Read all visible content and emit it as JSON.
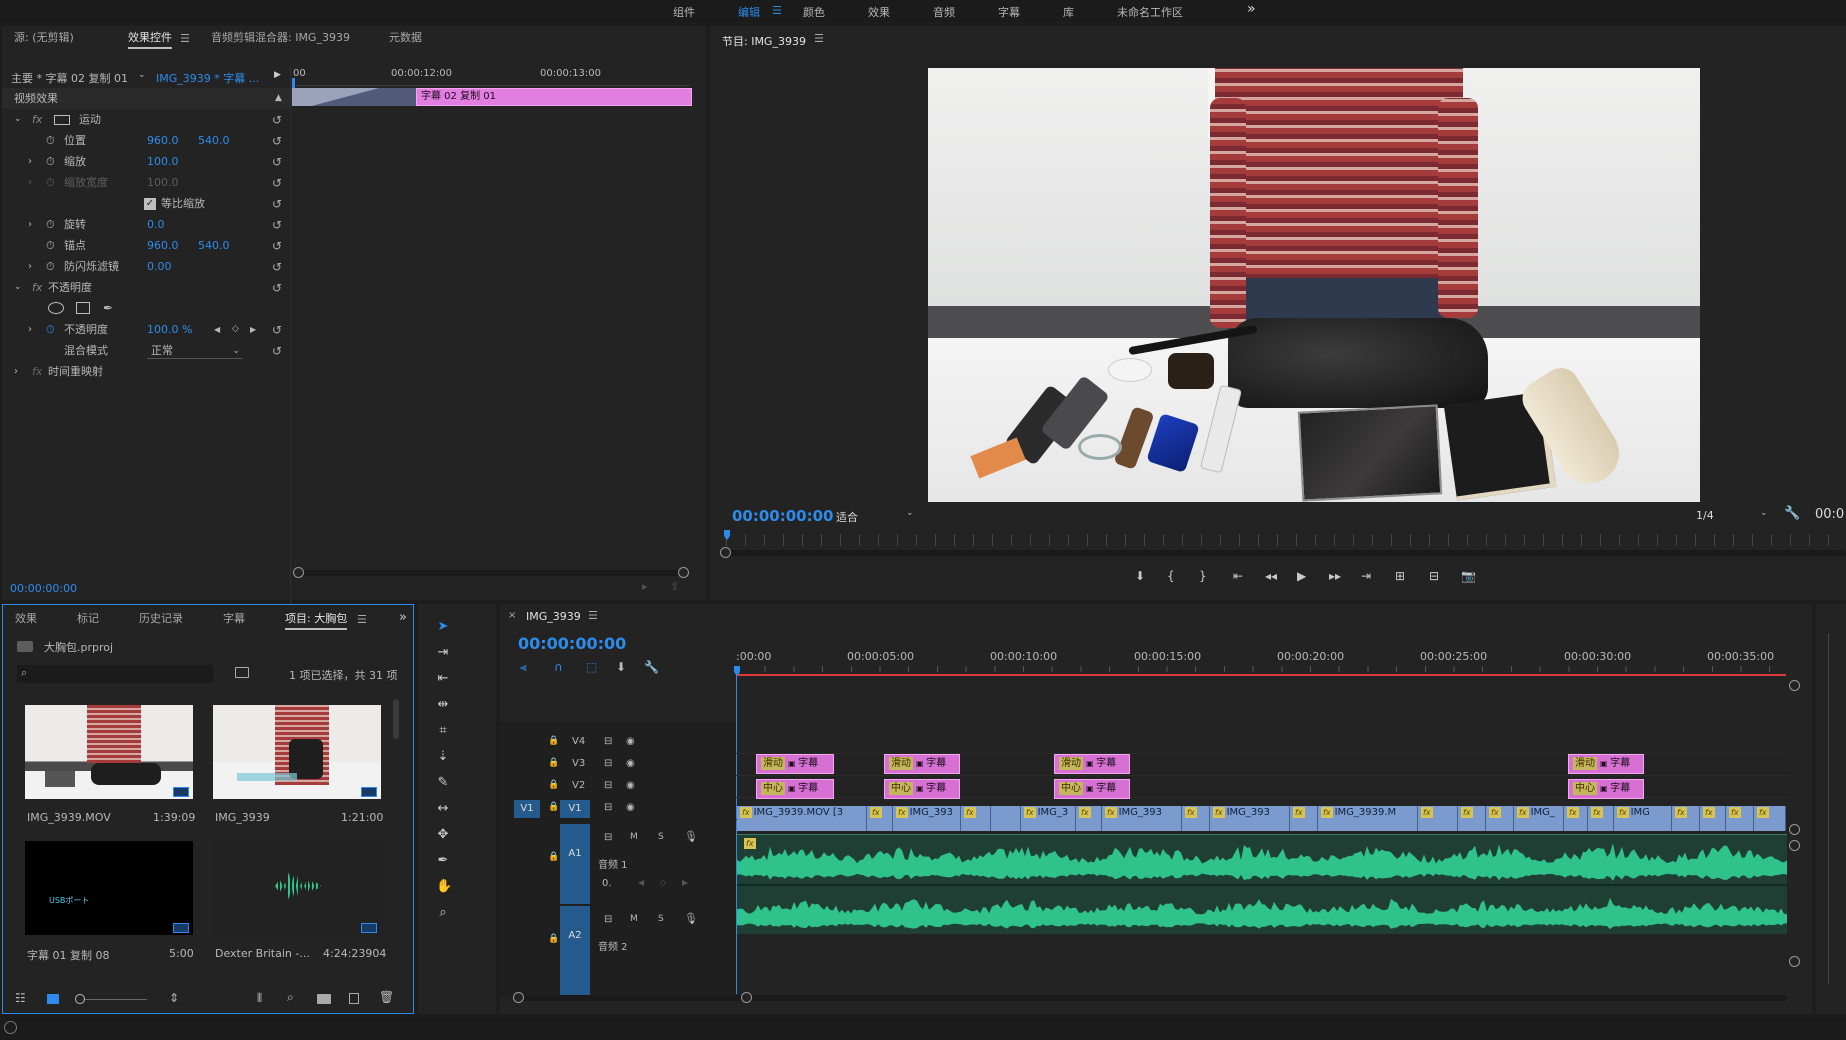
{
  "workspace_bar": {
    "tabs": [
      {
        "label": "组件"
      },
      {
        "label": "编辑"
      },
      {
        "label": "颜色"
      },
      {
        "label": "效果"
      },
      {
        "label": "音频"
      },
      {
        "label": "字幕"
      },
      {
        "label": "库"
      },
      {
        "label": "未命名工作区"
      }
    ],
    "active_index": 1,
    "more": "»"
  },
  "effect_controls": {
    "tabs": [
      {
        "label": "源: (无剪辑)"
      },
      {
        "label": "效果控件"
      },
      {
        "label": "音频剪辑混合器: IMG_3939"
      },
      {
        "label": "元数据"
      }
    ],
    "clip_master": "主要 * 字幕 02 复制 01",
    "clip_sequence": "IMG_3939 * 字幕 ...",
    "ruler": [
      "00",
      "00:00:12:00",
      "00:00:13:00"
    ],
    "clip_bar_label": "字幕 02 复制 01",
    "section_label": "视频效果",
    "motion": "运动",
    "position": {
      "label": "位置",
      "x": "960.0",
      "y": "540.0"
    },
    "scale": {
      "label": "缩放",
      "value": "100.0"
    },
    "scale_width": {
      "label": "缩放宽度",
      "value": "100.0"
    },
    "uniform_scale": "等比缩放",
    "rotation": {
      "label": "旋转",
      "value": "0.0"
    },
    "anchor": {
      "label": "锚点",
      "x": "960.0",
      "y": "540.0"
    },
    "antiflicker": {
      "label": "防闪烁滤镜",
      "value": "0.00"
    },
    "opacity_group": "不透明度",
    "opacity": {
      "label": "不透明度",
      "value": "100.0 %"
    },
    "blend_mode": {
      "label": "混合模式",
      "value": "正常"
    },
    "time_remap": "时间重映射",
    "timecode": "00:00:00:00"
  },
  "program_monitor": {
    "title": "节目: IMG_3939",
    "timecode": "00:00:00:00",
    "fit": "适合",
    "resolution": "1/4",
    "right_timecode": "00:0"
  },
  "project_panel": {
    "tabs": [
      {
        "label": "效果"
      },
      {
        "label": "标记"
      },
      {
        "label": "历史记录"
      },
      {
        "label": "字幕"
      },
      {
        "label": "项目: 大胸包"
      }
    ],
    "project_file": "大胸包.prproj",
    "search_placeholder": "",
    "selection_info": "1 项已选择，共 31 项",
    "items": [
      {
        "name": "IMG_3939.MOV",
        "duration": "1:39:09"
      },
      {
        "name": "IMG_3939",
        "duration": "1:21:00"
      },
      {
        "name": "字幕 01 复制 08",
        "duration": "5:00",
        "thumb_text": "USBポート"
      },
      {
        "name": "Dexter Britain -...",
        "duration": "4:24:23904"
      }
    ]
  },
  "timeline": {
    "sequence_tab": "IMG_3939",
    "timecode": "00:00:00:00",
    "ruler": [
      ":00:00",
      "00:00:05:00",
      "00:00:10:00",
      "00:00:15:00",
      "00:00:20:00",
      "00:00:25:00",
      "00:00:30:00",
      "00:00:35:00"
    ],
    "tracks": {
      "v4": "V4",
      "v3": "V3",
      "v2": "V2",
      "v1": "V1",
      "v1_source": "V1",
      "a1": "A1",
      "a1_name": "音频 1",
      "a2": "A2",
      "a2_name": "音频 2",
      "mute": "M",
      "solo": "S",
      "audio_val": "0."
    },
    "v1_clips": [
      "IMG_3939.MOV [3",
      "IMG_393",
      "IMG_3",
      "IMG_393",
      "IMG_393",
      "IMG_3939.M",
      "IMG_",
      "IMG"
    ],
    "title_label_top": "滑动",
    "title_label_bottom": "中心",
    "title_clip_text": "字幕"
  },
  "colors": {
    "accent_blue": "#2d8ceb",
    "title_clip": "#d670d3",
    "video_clip": "#7b9bcf",
    "audio_wave": "#2fc28b",
    "playhead_red": "#e03a3a"
  }
}
